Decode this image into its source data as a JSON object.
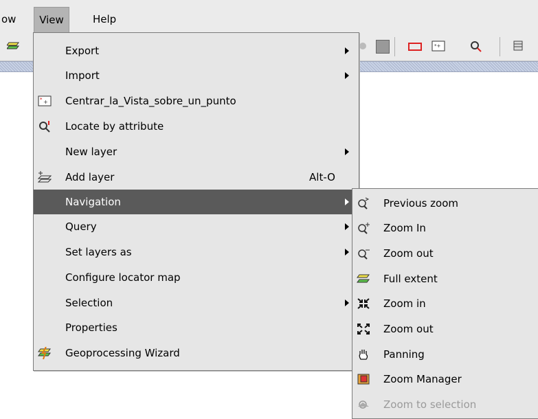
{
  "menubar": {
    "window_label": "ow",
    "view_label": "View",
    "help_label": "Help"
  },
  "view_menu": {
    "items": [
      {
        "label": "Export",
        "submenu": true
      },
      {
        "label": "Import",
        "submenu": true
      },
      {
        "label": "Centrar_la_Vista_sobre_un_punto",
        "icon": "center-point-icon"
      },
      {
        "label": "Locate by attribute",
        "icon": "locate-icon"
      },
      {
        "label": "New layer",
        "submenu": true
      },
      {
        "label": "Add layer",
        "icon": "add-layer-icon",
        "shortcut": "Alt-O"
      },
      {
        "label": "Navigation",
        "submenu": true,
        "highlighted": true
      },
      {
        "label": "Query",
        "submenu": true
      },
      {
        "label": "Set layers as",
        "submenu": true
      },
      {
        "label": "Configure locator map"
      },
      {
        "label": "Selection",
        "submenu": true
      },
      {
        "label": "Properties"
      },
      {
        "label": "Geoprocessing Wizard",
        "icon": "geoprocessing-icon"
      }
    ]
  },
  "navigation_menu": {
    "items": [
      {
        "label": "Previous zoom",
        "icon": "previous-zoom-icon"
      },
      {
        "label": "Zoom In",
        "icon": "zoom-in-icon"
      },
      {
        "label": "Zoom out",
        "icon": "zoom-out-icon"
      },
      {
        "label": "Full extent",
        "icon": "full-extent-icon"
      },
      {
        "label": "Zoom in",
        "icon": "zoom-in-arrows-icon"
      },
      {
        "label": "Zoom out",
        "icon": "zoom-out-arrows-icon"
      },
      {
        "label": "Panning",
        "icon": "hand-icon"
      },
      {
        "label": "Zoom Manager",
        "icon": "zoom-manager-icon"
      },
      {
        "label": "Zoom to selection",
        "icon": "zoom-selection-icon",
        "disabled": true
      }
    ]
  },
  "colors": {
    "menu_bg": "#e6e6e6",
    "highlight": "#5a5a5a",
    "menubar_bg": "#ebebeb",
    "disabled_text": "#9a9a9a"
  }
}
